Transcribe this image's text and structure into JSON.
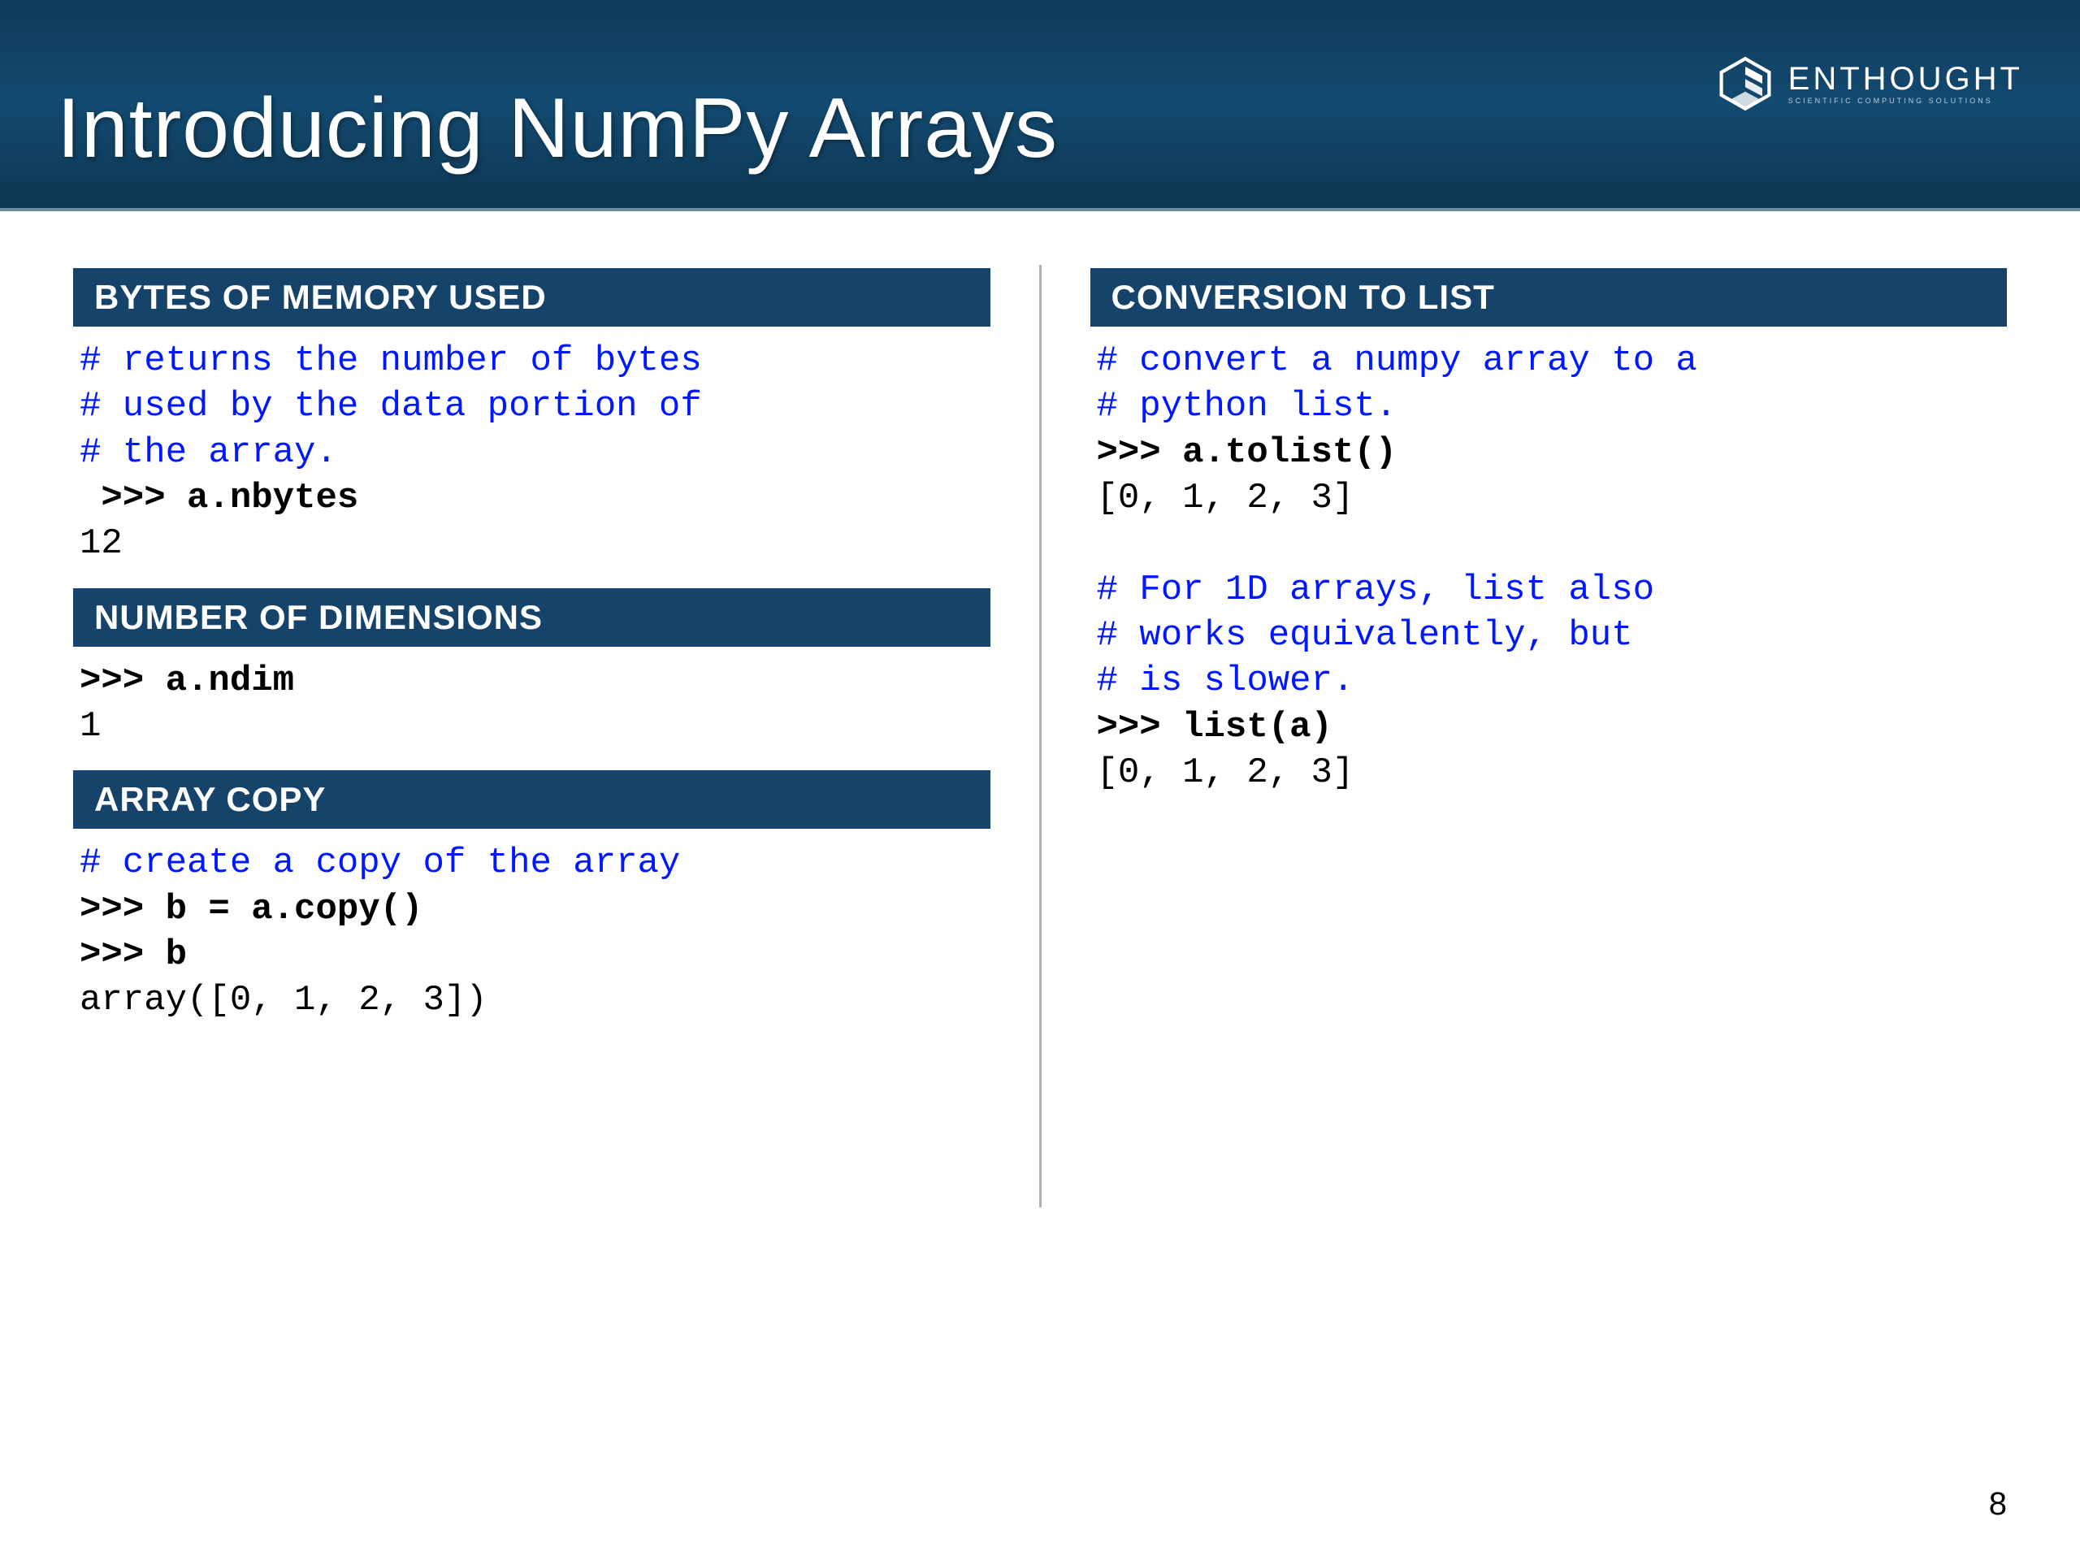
{
  "header": {
    "title": "Introducing NumPy Arrays",
    "brand_name": "ENTHOUGHT",
    "brand_sub": "SCIENTIFIC COMPUTING SOLUTIONS"
  },
  "sections": {
    "bytes": {
      "title": "BYTES OF MEMORY USED",
      "comment1": "# returns the number of bytes",
      "comment2": "# used by the data portion of",
      "comment3": "# the array.",
      "prompt1": " >>> a.nbytes",
      "out1": "12"
    },
    "ndim": {
      "title": "NUMBER OF DIMENSIONS",
      "prompt1": ">>> a.ndim",
      "out1": "1"
    },
    "copy": {
      "title": "ARRAY COPY",
      "comment1": "# create a copy of the array",
      "prompt1": ">>> b = a.copy()",
      "prompt2": ">>> b",
      "out1": "array([0, 1, 2, 3])"
    },
    "tolist": {
      "title": "CONVERSION TO LIST",
      "comment1": "# convert a numpy array to a",
      "comment2": "# python list.",
      "prompt1": ">>> a.tolist()",
      "out1": "[0, 1, 2, 3]",
      "comment3": "# For 1D arrays, list also",
      "comment4": "# works equivalently, but",
      "comment5": "# is slower.",
      "prompt2": ">>> list(a)",
      "out2": "[0, 1, 2, 3]"
    }
  },
  "page_number": "8"
}
